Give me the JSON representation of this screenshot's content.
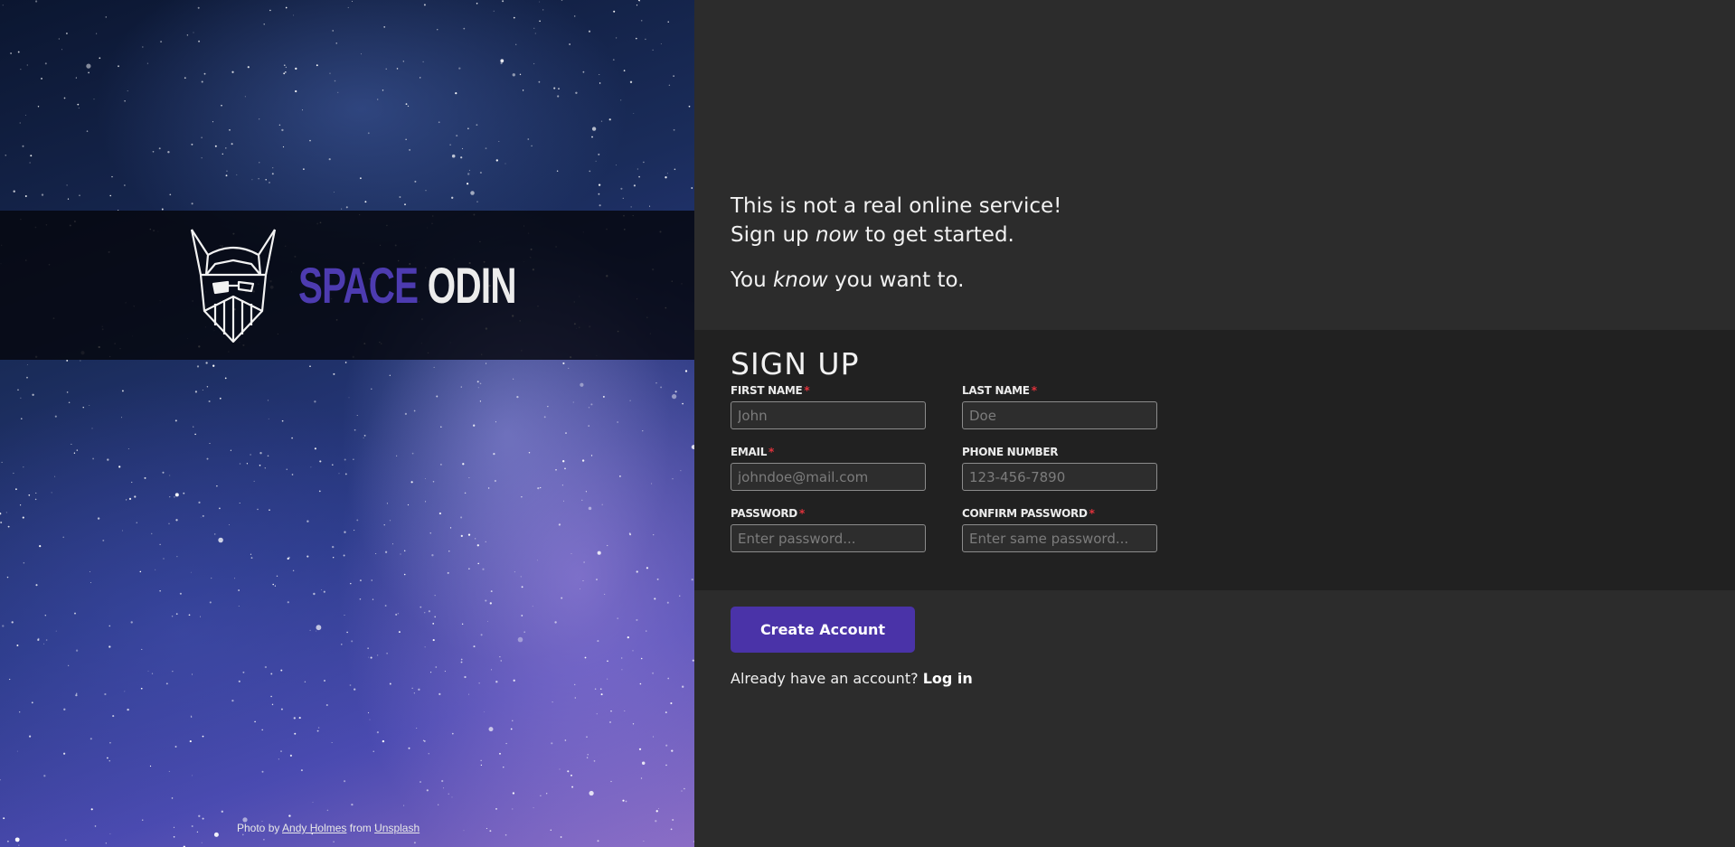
{
  "brand": {
    "word1": "SPACE",
    "word2": "ODIN",
    "logo_icon": "viking-helmet-icon",
    "colors": {
      "space": "#4d3bb0",
      "odin": "#ececec"
    }
  },
  "credit": {
    "prefix": "Photo by",
    "author": "Andy Holmes",
    "middle": "from",
    "source": "Unsplash"
  },
  "intro": {
    "line1": "This is not a real online service!",
    "line2_before": "Sign up",
    "line2_em": "now",
    "line2_after": "to get started.",
    "line3_before": "You",
    "line3_em": "know",
    "line3_after": "you want to."
  },
  "form": {
    "title": "SIGN UP",
    "required_mark": "*",
    "fields": {
      "first_name": {
        "label": "FIRST NAME",
        "placeholder": "John",
        "required": true
      },
      "last_name": {
        "label": "LAST NAME",
        "placeholder": "Doe",
        "required": true
      },
      "email": {
        "label": "EMAIL",
        "placeholder": "johndoe@mail.com",
        "required": true
      },
      "phone": {
        "label": "PHONE NUMBER",
        "placeholder": "123-456-7890",
        "required": false
      },
      "password": {
        "label": "PASSWORD",
        "placeholder": "Enter password...",
        "required": true
      },
      "confirm_password": {
        "label": "CONFIRM PASSWORD",
        "placeholder": "Enter same password...",
        "required": true
      }
    }
  },
  "actions": {
    "create_label": "Create Account",
    "login_prompt": "Already have an account?",
    "login_link": "Log in"
  },
  "colors": {
    "accent": "#4a33a8",
    "required": "#e0323c",
    "page_bg": "#2c2c2c",
    "form_bg": "#212121"
  }
}
